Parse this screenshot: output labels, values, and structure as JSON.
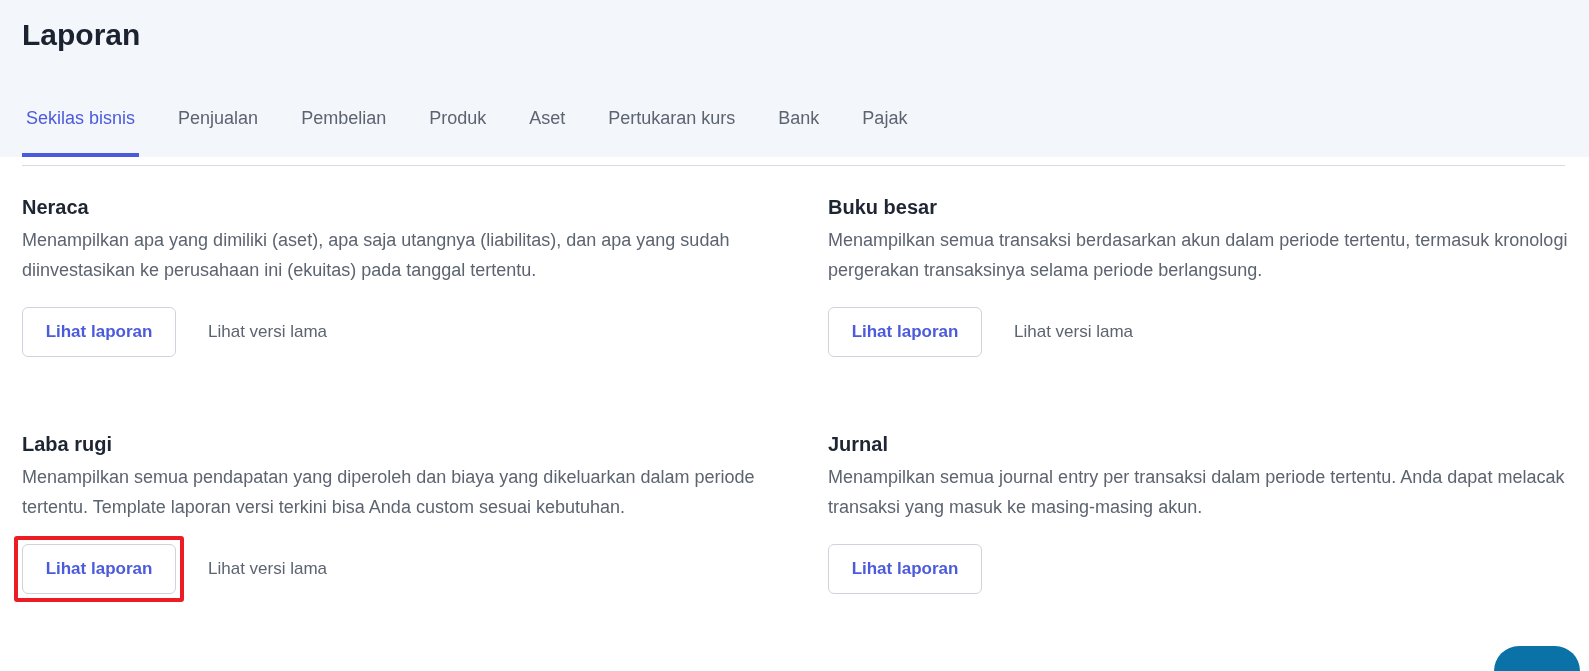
{
  "page_title": "Laporan",
  "tabs": [
    {
      "label": "Sekilas bisnis",
      "selected": true
    },
    {
      "label": "Penjualan",
      "selected": false
    },
    {
      "label": "Pembelian",
      "selected": false
    },
    {
      "label": "Produk",
      "selected": false
    },
    {
      "label": "Aset",
      "selected": false
    },
    {
      "label": "Pertukaran kurs",
      "selected": false
    },
    {
      "label": "Bank",
      "selected": false
    },
    {
      "label": "Pajak",
      "selected": false
    }
  ],
  "reports": [
    {
      "title": "Neraca",
      "description": "Menampilkan apa yang dimiliki (aset), apa saja utangnya (liabilitas), dan apa yang sudah diinvestasikan ke perusahaan ini (ekuitas) pada tanggal tertentu.",
      "view_button": "Lihat laporan",
      "highlighted": false,
      "old_version_link": "Lihat versi lama"
    },
    {
      "title": "Buku besar",
      "description": "Menampilkan semua transaksi berdasarkan akun dalam periode tertentu, termasuk kronologi pergerakan transaksinya selama periode berlangsung.",
      "view_button": "Lihat laporan",
      "highlighted": false,
      "old_version_link": "Lihat versi lama"
    },
    {
      "title": "Laba rugi",
      "description": "Menampilkan semua pendapatan yang diperoleh dan biaya yang dikeluarkan dalam periode tertentu. Template laporan versi terkini bisa Anda custom sesuai kebutuhan.",
      "view_button": "Lihat laporan",
      "highlighted": true,
      "old_version_link": "Lihat versi lama"
    },
    {
      "title": "Jurnal",
      "description": "Menampilkan semua journal entry per transaksi dalam periode tertentu. Anda dapat melacak transaksi yang masuk ke masing-masing akun.",
      "view_button": "Lihat laporan",
      "highlighted": false
    }
  ]
}
